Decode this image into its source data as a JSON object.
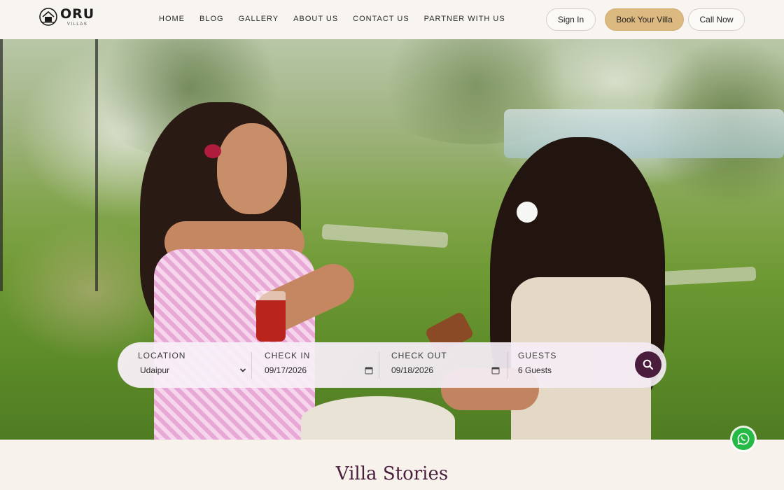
{
  "brand": {
    "name": "ORU",
    "tagline": "VILLAS"
  },
  "nav": {
    "items": [
      {
        "label": "HOME"
      },
      {
        "label": "BLOG"
      },
      {
        "label": "GALLERY"
      },
      {
        "label": "ABOUT US"
      },
      {
        "label": "CONTACT US"
      },
      {
        "label": "PARTNER WITH US"
      }
    ]
  },
  "actions": {
    "signin_label": "Sign In",
    "book_label": "Book Your Villa",
    "call_label": "Call Now"
  },
  "search": {
    "location_label": "LOCATION",
    "location_value": "Udaipur",
    "checkin_label": "CHECK IN",
    "checkin_value": "09/17/2026",
    "checkout_label": "CHECK OUT",
    "checkout_value": "09/18/2026",
    "guests_label": "GUESTS",
    "guests_value": "6 Guests"
  },
  "section": {
    "title": "Villa Stories"
  },
  "colors": {
    "accent": "#dcb980",
    "brand_dark": "#4a1d3c",
    "whatsapp": "#25b946"
  },
  "icons": [
    "logo-icon",
    "chevron-down-icon",
    "calendar-icon",
    "search-icon",
    "whatsapp-icon"
  ]
}
